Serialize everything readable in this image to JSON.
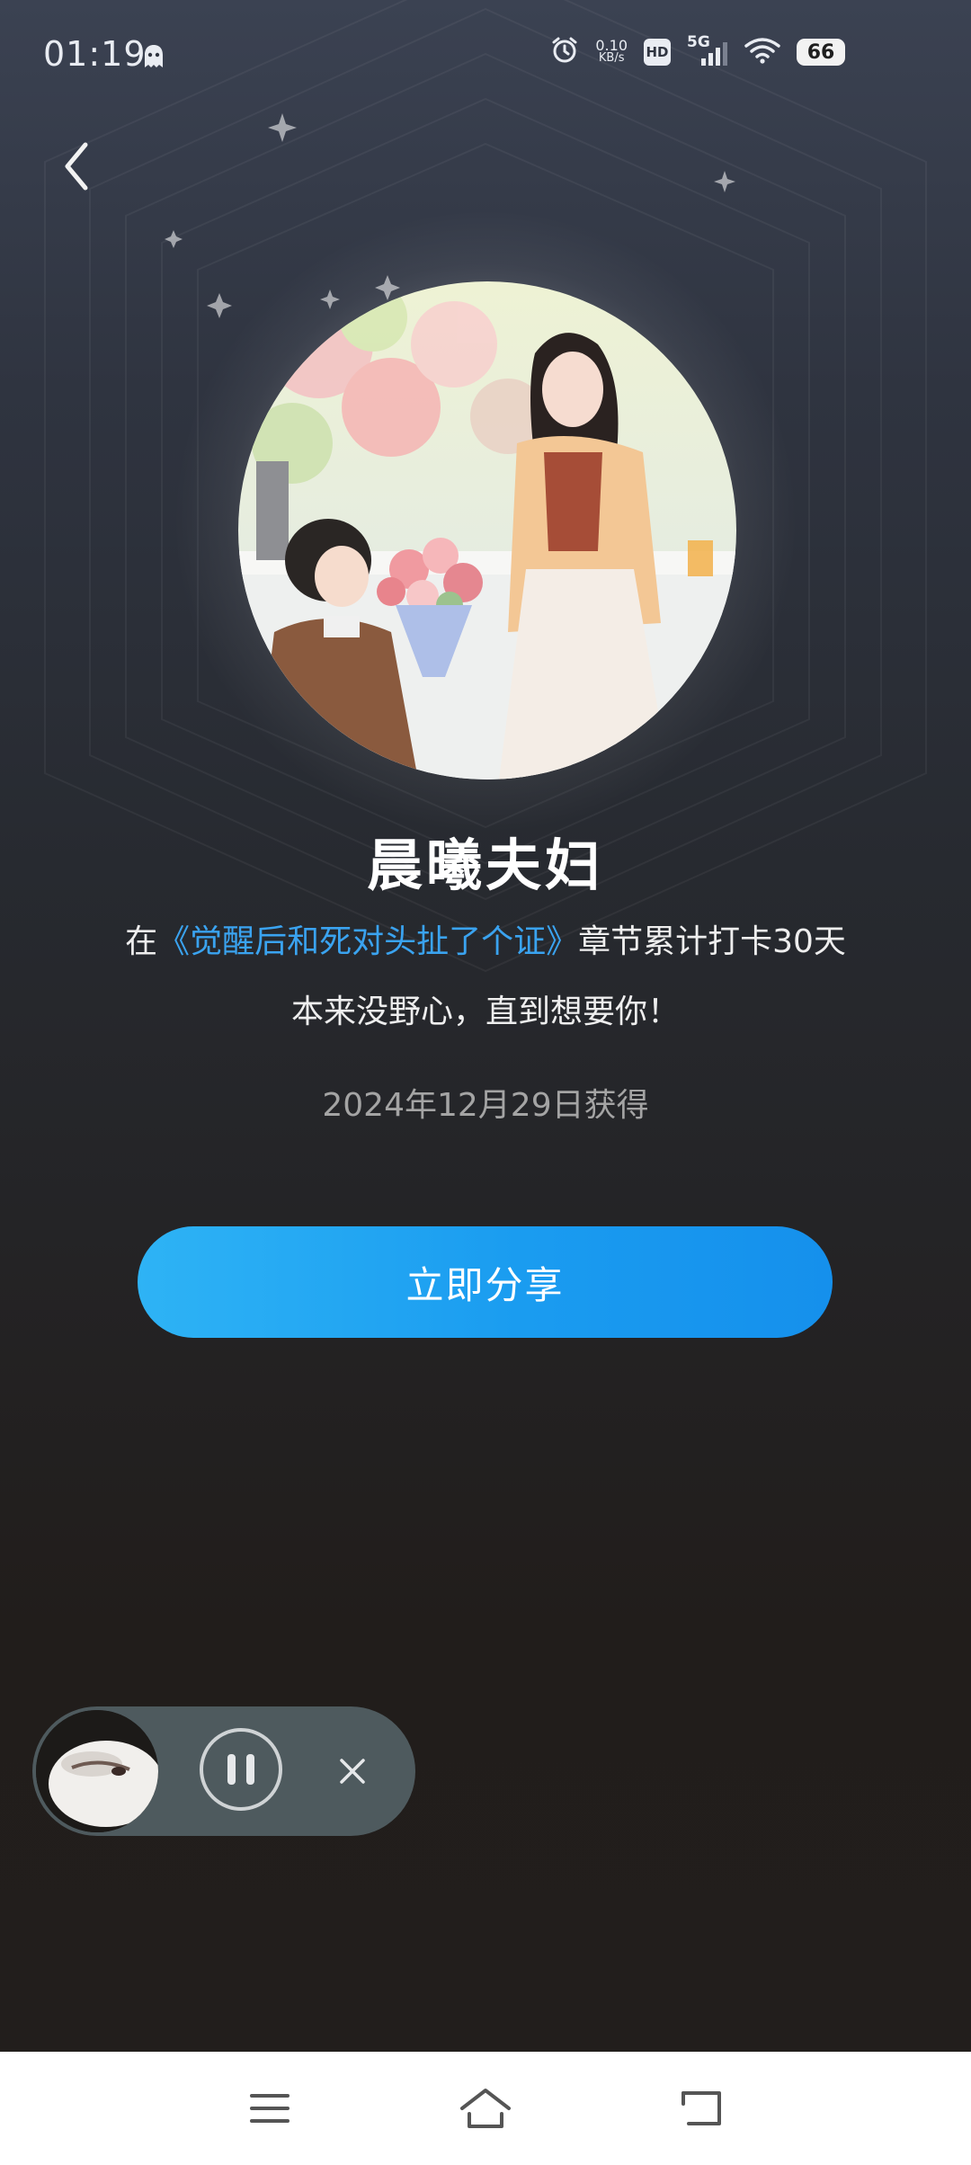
{
  "status_bar": {
    "time": "01:19",
    "net_speed_value": "0.10",
    "net_speed_unit": "KB/s",
    "hd_label": "HD",
    "network_label": "5G",
    "battery_level": "66",
    "icons": [
      "ghost-icon",
      "alarm-icon",
      "hd-icon",
      "signal-5g-icon",
      "wifi-icon",
      "battery-icon"
    ]
  },
  "badge": {
    "title": "晨曦夫妇",
    "desc_prefix": "在",
    "book_name": "《觉醒后和死对头扯了个证》",
    "desc_suffix": "章节累计打卡30天",
    "quote": "本来没野心，直到想要你！",
    "date": "2024年12月29日获得"
  },
  "actions": {
    "share_label": "立即分享"
  },
  "mini_player": {
    "state": "playing",
    "icons": [
      "pause-icon",
      "close-icon"
    ]
  },
  "nav_bar": {
    "icons": [
      "menu-icon",
      "home-icon",
      "back-icon"
    ]
  },
  "colors": {
    "accent": "#1a9cf0",
    "link": "#3aa3f0",
    "background_top": "#3b4252",
    "background_bottom": "#221e1c"
  }
}
